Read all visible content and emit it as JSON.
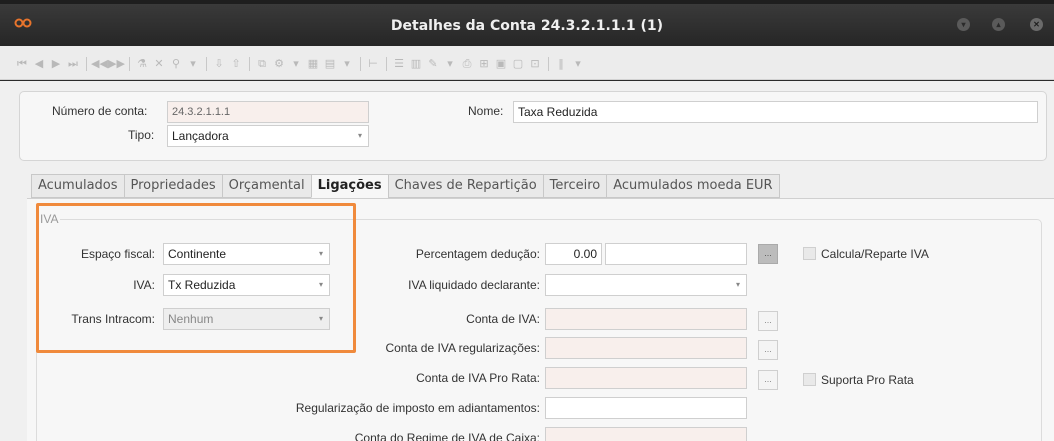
{
  "window": {
    "title": "Detalhes da Conta 24.3.2.1.1.1 (1)"
  },
  "header": {
    "numero_label": "Número de conta:",
    "numero_value": "24.3.2.1.1.1",
    "tipo_label": "Tipo:",
    "tipo_value": "Lançadora",
    "nome_label": "Nome:",
    "nome_value": "Taxa Reduzida"
  },
  "tabs": [
    "Acumulados",
    "Propriedades",
    "Orçamental",
    "Ligações",
    "Chaves de Repartição",
    "Terceiro",
    "Acumulados moeda EUR"
  ],
  "active_tab": "Ligações",
  "iva_group": {
    "title": "IVA",
    "espaco_label": "Espaço fiscal:",
    "espaco_value": "Continente",
    "iva_label": "IVA:",
    "iva_value": "Tx Reduzida",
    "trans_label": "Trans Intracom:",
    "trans_value": "Nenhum",
    "percentagem_label": "Percentagem dedução:",
    "percentagem_value": "0.00",
    "liquidado_label": "IVA liquidado declarante:",
    "conta_iva_label": "Conta de IVA:",
    "conta_reg_label": "Conta de IVA regularizações:",
    "conta_prorata_label": "Conta de IVA Pro Rata:",
    "regularizacao_label": "Regularização de imposto em adiantamentos:",
    "regime_caixa_label": "Conta do Regime de IVA de Caixa:",
    "calcula_label": "Calcula/Reparte IVA",
    "suporta_label": "Suporta Pro Rata",
    "dots_label": "..."
  },
  "colors": {
    "highlight": "#f08a3c",
    "titlebar": "#2b2b2b",
    "readonly_field": "#f8efec"
  }
}
